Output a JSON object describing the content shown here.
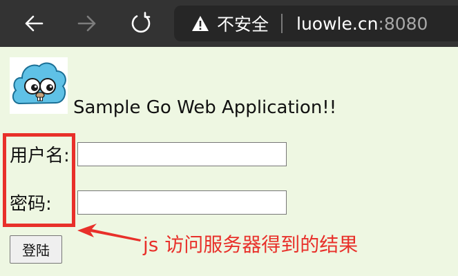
{
  "browser": {
    "security_label": "不安全",
    "url_host": "luowle.cn",
    "url_port": ":8080",
    "icons": {
      "back": "arrow-left-icon",
      "forward": "arrow-right-icon",
      "reload": "reload-icon",
      "warning": "warning-triangle-icon"
    }
  },
  "page": {
    "title": "Sample Go Web Application!!",
    "username_label": "用户名:",
    "password_label": "密码:",
    "username_value": "",
    "password_value": "",
    "login_label": "登陆"
  },
  "annotation": {
    "text": "js 访问服务器得到的结果",
    "color": "#e8302a"
  }
}
